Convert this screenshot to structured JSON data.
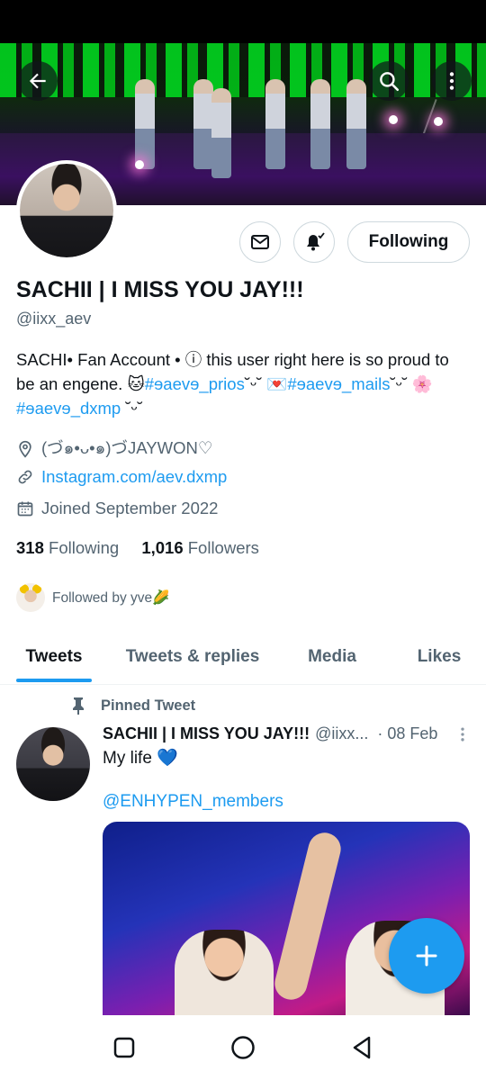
{
  "profile": {
    "name": "SACHII | I MISS YOU JAY!!!",
    "handle": "@iixx_aev",
    "bio_text_1": "SACHI• Fan Account • ⓘ this user right here is so proud to be an engene. 🐱",
    "bio_link_1": "#ɘaevɘ_prios",
    "bio_text_2": "˘ᵕ˘ 💌",
    "bio_link_2": "#ɘaevɘ_mails",
    "bio_text_3": "˘ᵕ˘ 🌸",
    "bio_link_3": "#ɘaevɘ_dxmp",
    "bio_text_4": " ˘ᵕ˘",
    "location": "(づ๑•ᴗ•๑)づJAYWON♡",
    "website": "Instagram.com/aev.dxmp",
    "joined": "Joined September 2022",
    "following_count": "318",
    "following_label": "Following",
    "followers_count": "1,016",
    "followers_label": "Followers",
    "followed_by": "Followed by yve🌽"
  },
  "actions": {
    "following_button": "Following"
  },
  "icons": {
    "back": "back-arrow-icon",
    "search": "search-icon",
    "more": "more-vertical-icon",
    "message": "envelope-icon",
    "notify": "bell-icon",
    "location": "location-pin-icon",
    "link": "link-icon",
    "calendar": "calendar-icon",
    "pin": "pin-icon",
    "compose": "plus-icon"
  },
  "tabs": [
    "Tweets",
    "Tweets & replies",
    "Media",
    "Likes"
  ],
  "tweet": {
    "pinned_label": "Pinned Tweet",
    "author_name": "SACHII | I MISS YOU JAY!!!",
    "author_handle": "@iixx...",
    "date": "· 08 Feb",
    "text": "My life 💙",
    "mention": "@ENHYPEN_members"
  },
  "colors": {
    "accent": "#1d9bf0",
    "text": "#0f1419",
    "secondary": "#536471",
    "border": "#cfd9de"
  }
}
